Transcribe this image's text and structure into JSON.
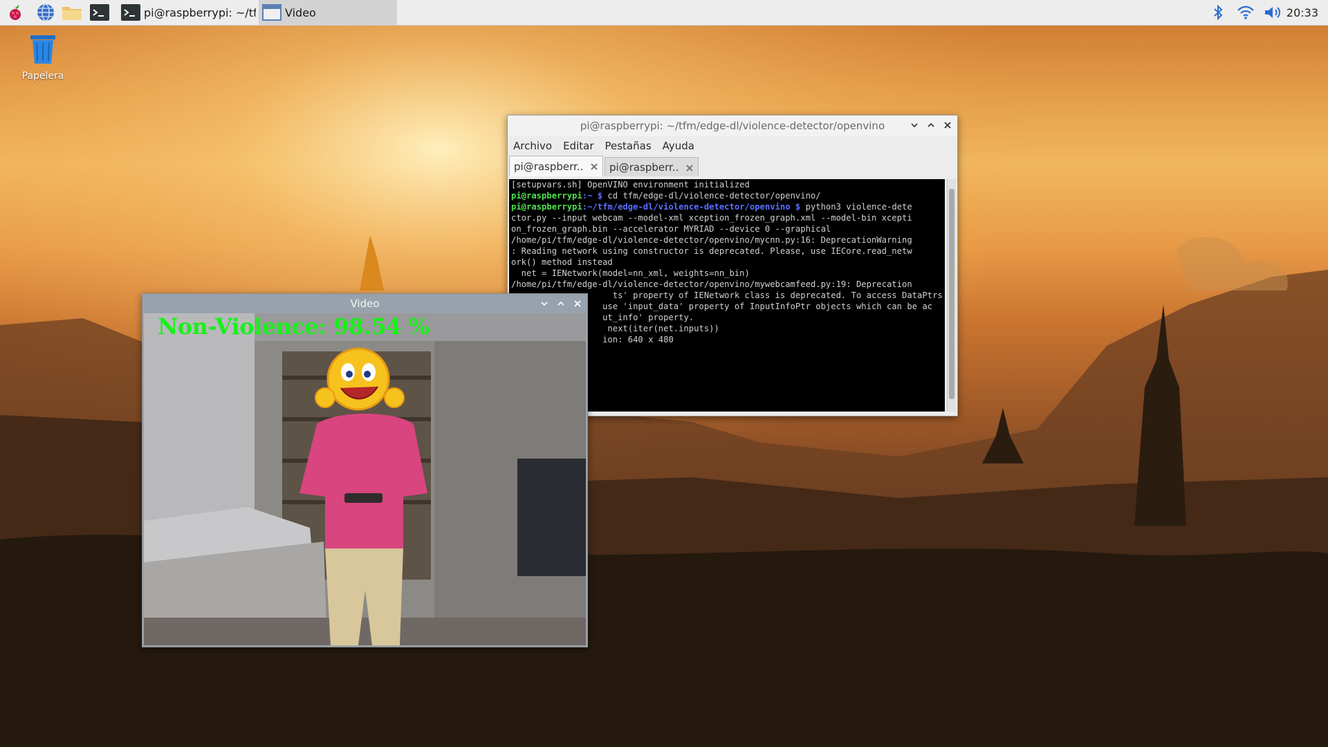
{
  "taskbar": {
    "launchers": [
      {
        "name": "raspberry-menu-icon"
      },
      {
        "name": "web-browser-icon"
      },
      {
        "name": "file-manager-icon"
      },
      {
        "name": "terminal-launcher-icon"
      }
    ],
    "tasks": [
      {
        "label": "pi@raspberrypi: ~/tf...",
        "icon": "terminal-icon"
      },
      {
        "label": "Video",
        "icon": "window-icon"
      }
    ],
    "clock": "20:33"
  },
  "desktop": {
    "trash_label": "Papelera"
  },
  "terminal": {
    "title": "pi@raspberrypi: ~/tfm/edge-dl/violence-detector/openvino",
    "menu": [
      "Archivo",
      "Editar",
      "Pestañas",
      "Ayuda"
    ],
    "tabs": [
      "pi@raspberr...",
      "pi@raspberr..."
    ],
    "lines": {
      "l1": "[setupvars.sh] OpenVINO environment initialized",
      "l2_user": "pi@raspberrypi",
      "l2_path": ":~ $",
      "l2_cmd": " cd tfm/edge-dl/violence-detector/openvino/",
      "l3_user": "pi@raspberrypi",
      "l3_path": ":~/tfm/edge-dl/violence-detector/openvino $",
      "l3_cmd": " python3 violence-dete",
      "l4": "ctor.py --input webcam --model-xml xception_frozen_graph.xml --model-bin xcepti",
      "l5": "on_frozen_graph.bin --accelerator MYRIAD --device 0 --graphical",
      "l6": "/home/pi/tfm/edge-dl/violence-detector/openvino/mycnn.py:16: DeprecationWarning",
      "l7": ": Reading network using constructor is deprecated. Please, use IECore.read_netw",
      "l8": "ork() method instead",
      "l9": "  net = IENetwork(model=nn_xml, weights=nn_bin)",
      "l10": "/home/pi/tfm/edge-dl/violence-detector/openvino/mywebcamfeed.py:19: Deprecation",
      "l11": "                    ts' property of IENetwork class is deprecated. To access DataPtrs",
      "l12": "                  use 'input_data' property of InputInfoPtr objects which can be ac",
      "l13": "                  ut_info' property.",
      "l14": "                   next(iter(net.inputs))",
      "l15": "                  ion: 640 x 480"
    }
  },
  "video": {
    "title": "Video",
    "overlay": "Non-Violence: 98.54 %"
  }
}
